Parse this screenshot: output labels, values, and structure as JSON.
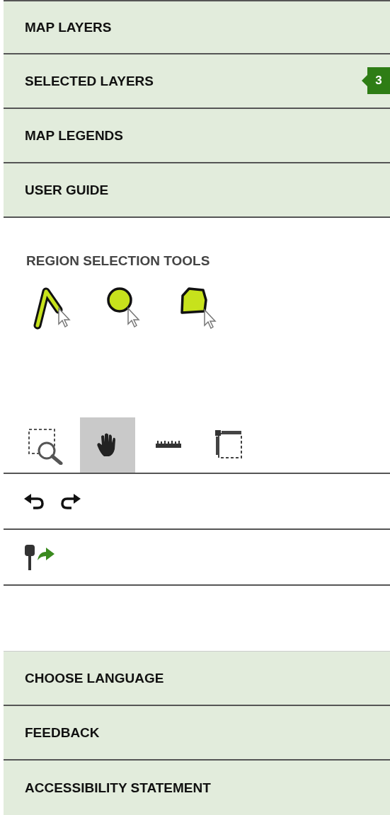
{
  "top_menu": [
    {
      "label": "MAP LAYERS"
    },
    {
      "label": "SELECTED LAYERS",
      "badge": "3"
    },
    {
      "label": "MAP LEGENDS"
    },
    {
      "label": "USER GUIDE"
    }
  ],
  "region_selection": {
    "heading": "REGION SELECTION TOOLS",
    "tools": [
      {
        "kind": "line"
      },
      {
        "kind": "circle"
      },
      {
        "kind": "polygon"
      }
    ]
  },
  "map_tools": [
    {
      "kind": "zoom-box",
      "selected": false
    },
    {
      "kind": "pan",
      "selected": true
    },
    {
      "kind": "measure-line",
      "selected": false
    },
    {
      "kind": "measure-area",
      "selected": false
    }
  ],
  "history_tools": [
    {
      "kind": "undo"
    },
    {
      "kind": "redo"
    }
  ],
  "location_tools": [
    {
      "kind": "go-to-location"
    }
  ],
  "bottom_menu": [
    {
      "label": "CHOOSE LANGUAGE"
    },
    {
      "label": "FEEDBACK"
    },
    {
      "label": "ACCESSIBILITY STATEMENT"
    }
  ]
}
